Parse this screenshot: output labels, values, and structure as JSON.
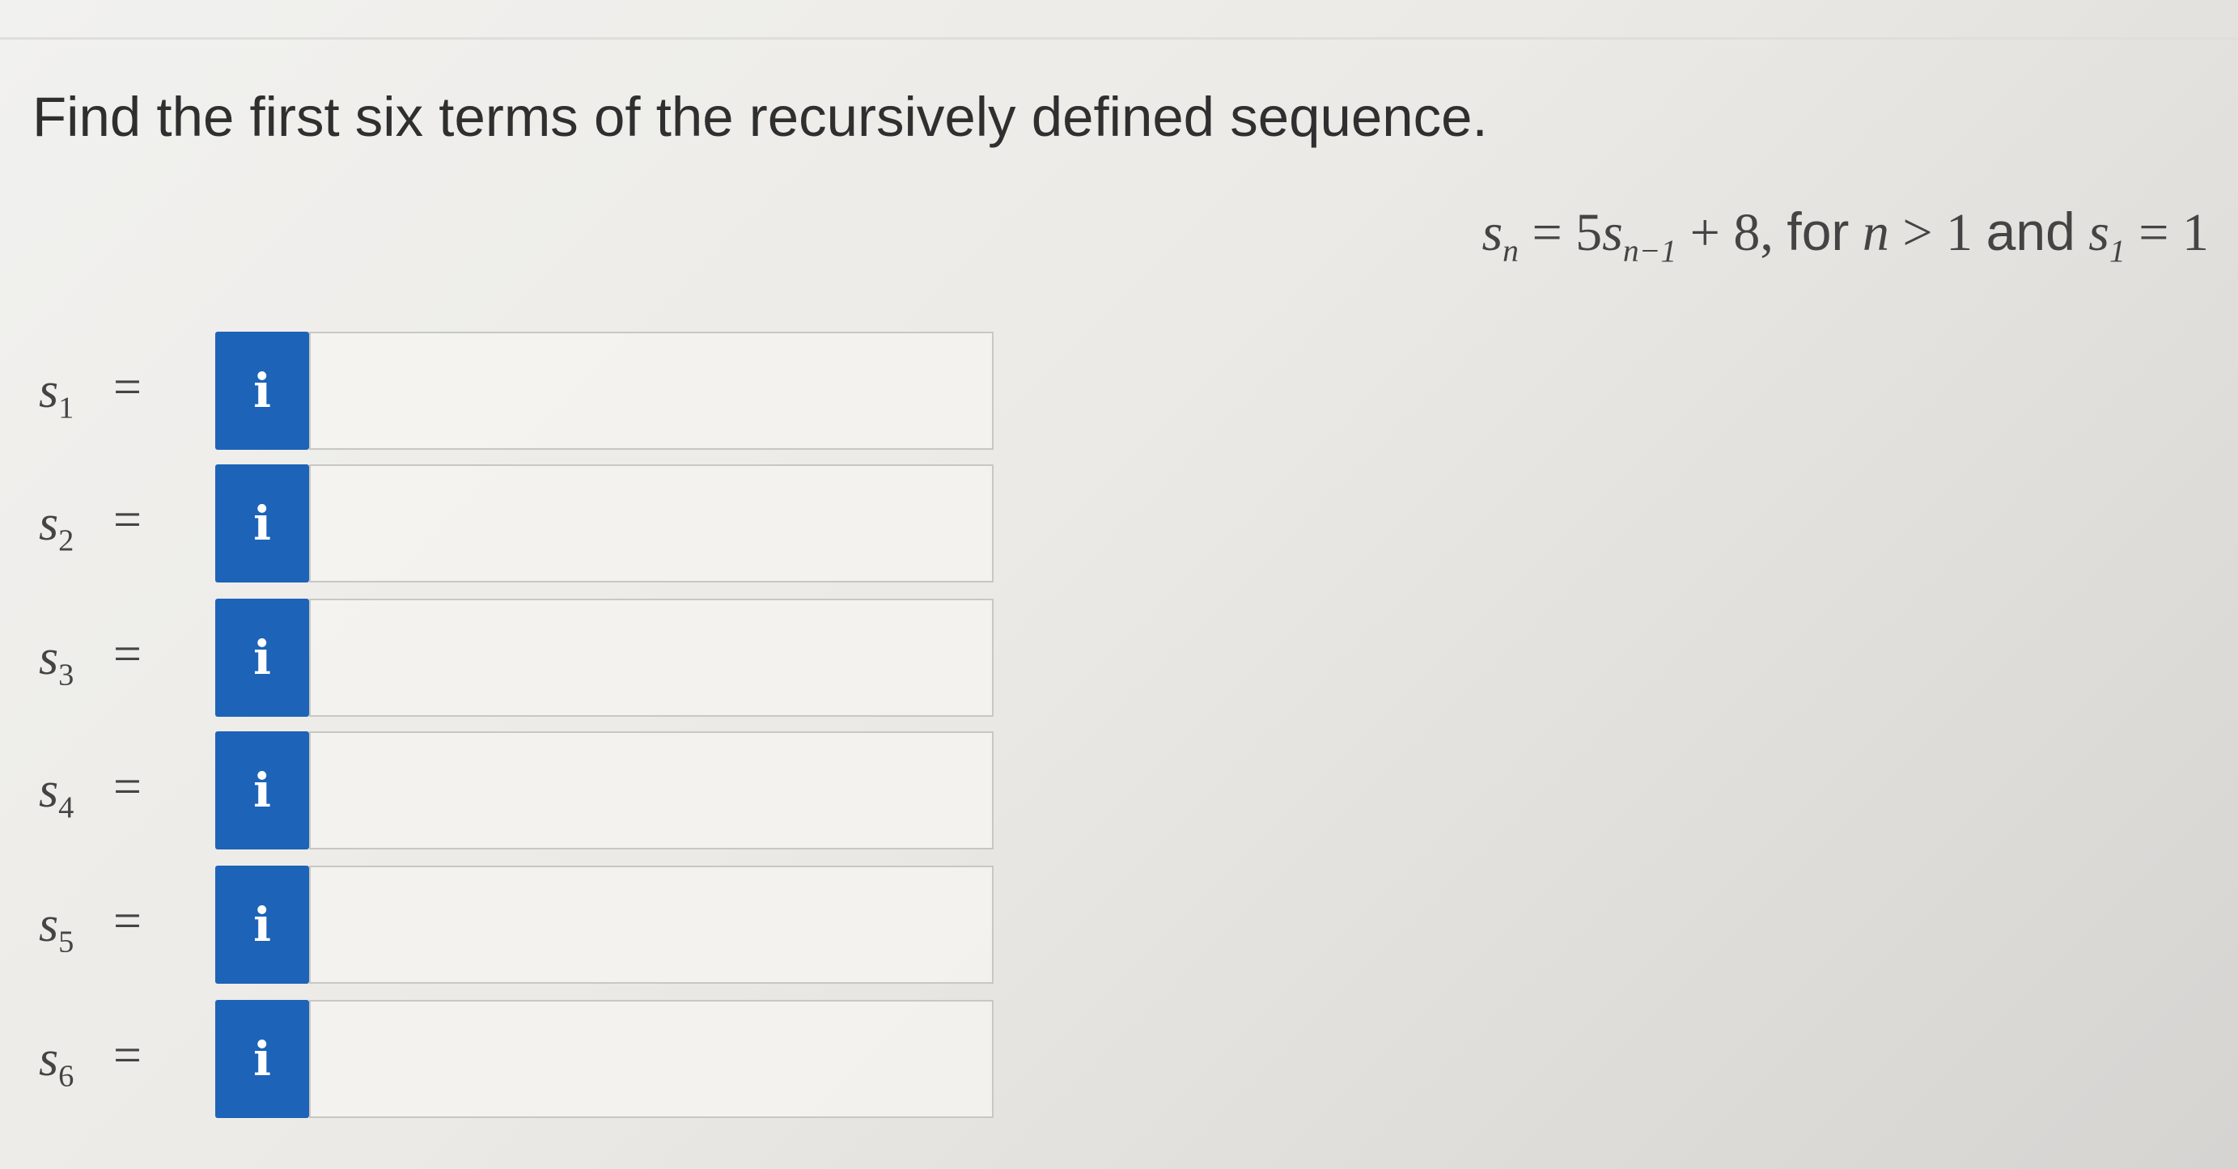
{
  "question": {
    "prompt": "Find the first six terms of the recursively defined sequence."
  },
  "formula": {
    "lhs_var": "s",
    "lhs_sub": "n",
    "equals": "=",
    "coef": "5",
    "rhs_var": "s",
    "rhs_sub": "n−1",
    "plus": "+ 8,",
    "for_text": "for",
    "n_var": "n",
    "gt": ">",
    "one": "1",
    "and_text": "and",
    "s1_var": "s",
    "s1_sub": "1",
    "equals2": "=",
    "s1_value": "1"
  },
  "answers": [
    {
      "var": "s",
      "sub": "1",
      "equals": "=",
      "info_icon": "i",
      "value": ""
    },
    {
      "var": "s",
      "sub": "2",
      "equals": "=",
      "info_icon": "i",
      "value": ""
    },
    {
      "var": "s",
      "sub": "3",
      "equals": "=",
      "info_icon": "i",
      "value": ""
    },
    {
      "var": "s",
      "sub": "4",
      "equals": "=",
      "info_icon": "i",
      "value": ""
    },
    {
      "var": "s",
      "sub": "5",
      "equals": "=",
      "info_icon": "i",
      "value": ""
    },
    {
      "var": "s",
      "sub": "6",
      "equals": "=",
      "info_icon": "i",
      "value": ""
    }
  ],
  "colors": {
    "info_button": "#1d63b8",
    "input_border": "#c9c7c3",
    "text": "#333333"
  },
  "icons": {
    "info": "info-icon"
  }
}
